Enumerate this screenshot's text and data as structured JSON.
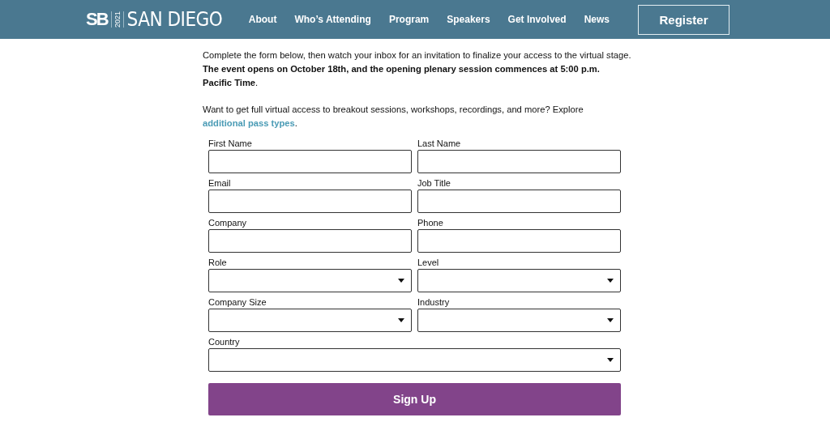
{
  "header": {
    "logo": {
      "mark": "SB",
      "year": "2021",
      "city": "SAN DIEGO"
    },
    "nav": [
      {
        "label": "About"
      },
      {
        "label": "Who’s Attending"
      },
      {
        "label": "Program"
      },
      {
        "label": "Speakers"
      },
      {
        "label": "Get Involved"
      },
      {
        "label": "News"
      }
    ],
    "register_button": "Register"
  },
  "intro": {
    "text": "Complete the form below, then watch your inbox for an invitation to finalize your access to the virtual stage. **The event opens on October 18th, and the opening plenary session commences at 5:00 p.m. Pacific Time**.",
    "explore_text": "Want to get full virtual access to breakout sessions, workshops, recordings, and more? Explore ",
    "explore_link": "additional pass types",
    "explore_suffix": "."
  },
  "form": {
    "fields": [
      {
        "label": "First Name",
        "kind": "text"
      },
      {
        "label": "Last Name",
        "kind": "text"
      },
      {
        "label": "Email",
        "kind": "text"
      },
      {
        "label": "Job Title",
        "kind": "text"
      },
      {
        "label": "Company",
        "kind": "text"
      },
      {
        "label": "Phone",
        "kind": "text"
      },
      {
        "label": "Role",
        "kind": "select"
      },
      {
        "label": "Level",
        "kind": "select"
      },
      {
        "label": "Company Size",
        "kind": "select"
      },
      {
        "label": "Industry",
        "kind": "select"
      },
      {
        "label": "Country",
        "kind": "select",
        "full": true
      }
    ],
    "submit": "Sign Up"
  }
}
